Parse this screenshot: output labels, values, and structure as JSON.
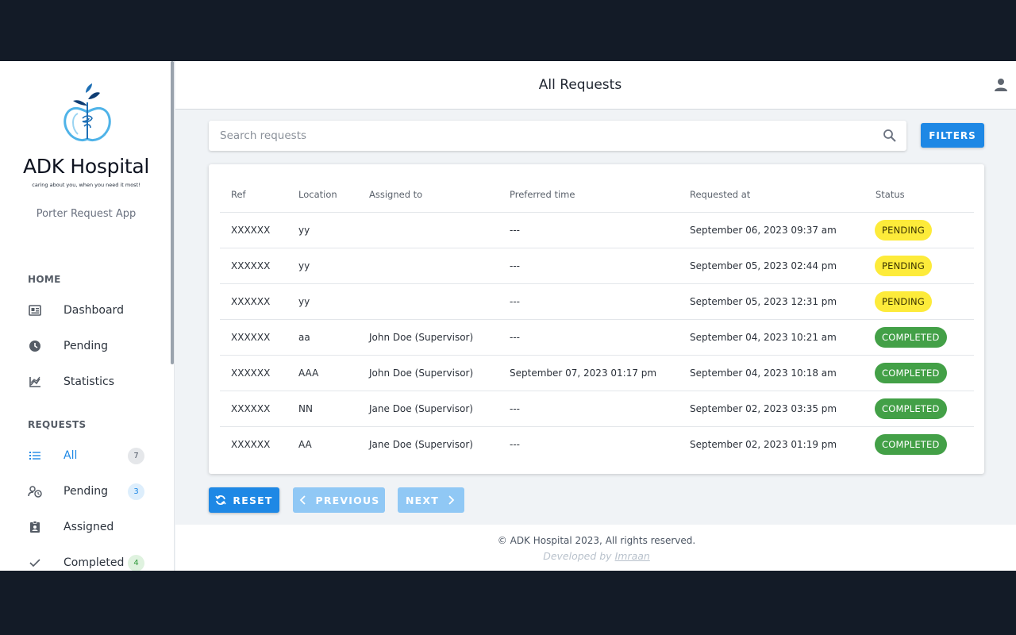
{
  "sidebar": {
    "brand": "ADK Hospital",
    "tagline": "caring about you, when you need it most!",
    "app_name": "Porter Request App",
    "sections": [
      {
        "label": "HOME",
        "items": [
          {
            "label": "Dashboard",
            "icon": "dashboard-icon"
          },
          {
            "label": "Pending",
            "icon": "clock-icon"
          },
          {
            "label": "Statistics",
            "icon": "chart-icon"
          }
        ]
      },
      {
        "label": "REQUESTS",
        "items": [
          {
            "label": "All",
            "icon": "list-icon",
            "count": "7",
            "active": true
          },
          {
            "label": "Pending",
            "icon": "user-clock-icon",
            "count": "3"
          },
          {
            "label": "Assigned",
            "icon": "assigned-badge-icon"
          },
          {
            "label": "Completed",
            "icon": "check-icon",
            "count": "4"
          }
        ]
      }
    ],
    "colors": {
      "active": "#1e88e5"
    }
  },
  "header": {
    "title": "All Requests",
    "user_icon": "user-icon"
  },
  "search": {
    "placeholder": "Search requests",
    "value": ""
  },
  "filters_label": "FILTERS",
  "table": {
    "columns": [
      "Ref",
      "Location",
      "Assigned to",
      "Preferred time",
      "Requested at",
      "Status"
    ],
    "rows": [
      {
        "ref": "XXXXXX",
        "location": "yy",
        "assigned": "",
        "preferred": "---",
        "requested": "September 06, 2023 09:37 am",
        "status": "PENDING"
      },
      {
        "ref": "XXXXXX",
        "location": "yy",
        "assigned": "",
        "preferred": "---",
        "requested": "September 05, 2023 02:44 pm",
        "status": "PENDING"
      },
      {
        "ref": "XXXXXX",
        "location": "yy",
        "assigned": "",
        "preferred": "---",
        "requested": "September 05, 2023 12:31 pm",
        "status": "PENDING"
      },
      {
        "ref": "XXXXXX",
        "location": "aa",
        "assigned": "John Doe (Supervisor)",
        "preferred": "---",
        "requested": "September 04, 2023 10:21 am",
        "status": "COMPLETED"
      },
      {
        "ref": "XXXXXX",
        "location": "AAA",
        "assigned": "John Doe (Supervisor)",
        "preferred": "September 07, 2023 01:17 pm",
        "requested": "September 04, 2023 10:18 am",
        "status": "COMPLETED"
      },
      {
        "ref": "XXXXXX",
        "location": "NN",
        "assigned": "Jane Doe (Supervisor)",
        "preferred": "---",
        "requested": "September 02, 2023 03:35 pm",
        "status": "COMPLETED"
      },
      {
        "ref": "XXXXXX",
        "location": "AA",
        "assigned": "Jane Doe (Supervisor)",
        "preferred": "---",
        "requested": "September 02, 2023 01:19 pm",
        "status": "COMPLETED"
      }
    ]
  },
  "pager": {
    "reset": "RESET",
    "previous": "PREVIOUS",
    "next": "NEXT"
  },
  "footer": {
    "copyright": "© ADK Hospital 2023, All rights reserved.",
    "dev_prefix": "Developed by",
    "dev_name": "Imraan"
  }
}
